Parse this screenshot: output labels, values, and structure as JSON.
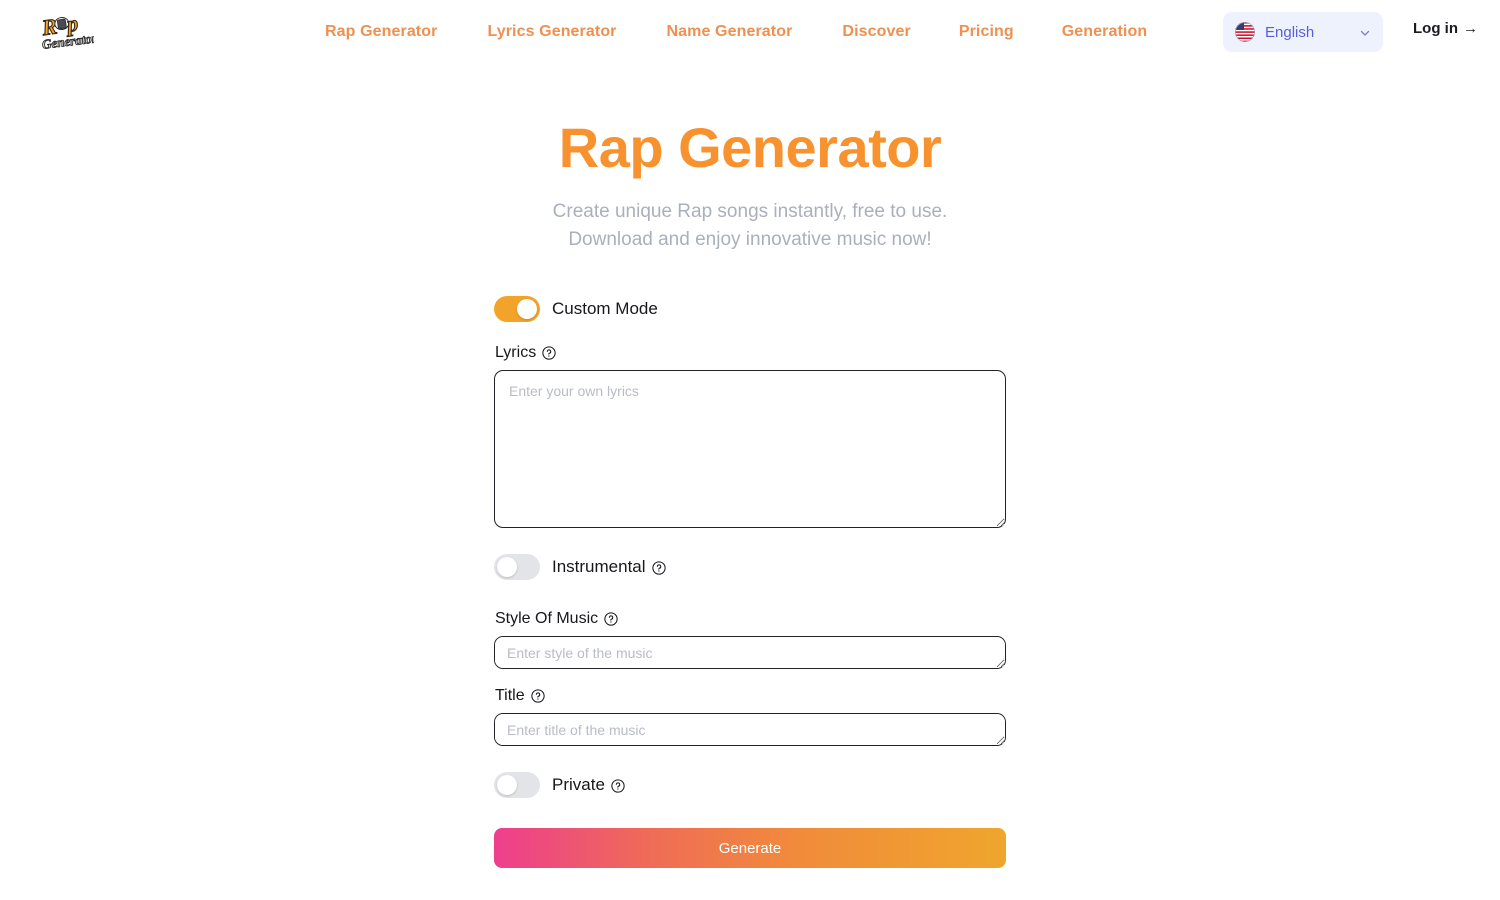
{
  "header": {
    "logo_alt": "Rap Generator",
    "nav": [
      {
        "label": "Rap Generator"
      },
      {
        "label": "Lyrics Generator"
      },
      {
        "label": "Name Generator"
      },
      {
        "label": "Discover"
      },
      {
        "label": "Pricing"
      },
      {
        "label": "Generation"
      }
    ],
    "language": {
      "label": "English",
      "flag": "us-flag-icon",
      "chevron": "chevron-down-icon"
    },
    "login_label": "Log in",
    "login_arrow": "→"
  },
  "hero": {
    "title": "Rap Generator",
    "subtitle_line1": "Create unique Rap songs instantly, free to use.",
    "subtitle_line2": "Download and enjoy innovative music now!"
  },
  "form": {
    "custom_mode": {
      "label": "Custom Mode",
      "state": "on"
    },
    "lyrics": {
      "label": "Lyrics",
      "help": "help-circle-icon",
      "placeholder": "Enter your own lyrics",
      "value": ""
    },
    "instrumental": {
      "label": "Instrumental",
      "help": "help-circle-icon",
      "state": "off"
    },
    "style": {
      "label": "Style Of Music",
      "help": "help-circle-icon",
      "placeholder": "Enter style of the music",
      "value": ""
    },
    "title": {
      "label": "Title",
      "help": "help-circle-icon",
      "placeholder": "Enter title of the music",
      "value": ""
    },
    "private": {
      "label": "Private",
      "help": "help-circle-icon",
      "state": "off"
    },
    "generate_label": "Generate"
  },
  "colors": {
    "brand_orange": "#f7922f",
    "nav_link": "#f09050",
    "toggle_on": "#f2a42a",
    "toggle_off": "#e3e4e8",
    "lang_bg": "#eef2fd",
    "lang_text": "#5b5fd6",
    "subtitle": "#aab0bb",
    "gradient_start": "#ee3e8e",
    "gradient_end": "#efa62c"
  }
}
